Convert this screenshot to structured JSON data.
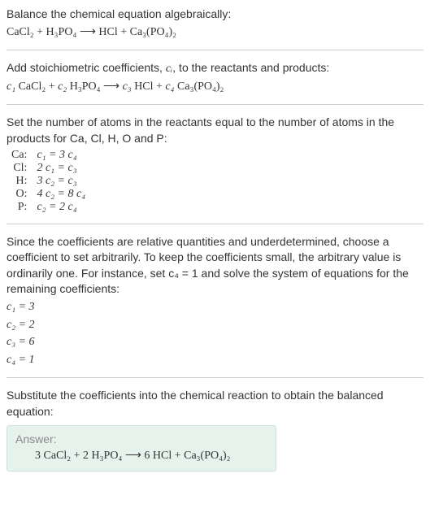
{
  "intro1": "Balance the chemical equation algebraically:",
  "eq1": "CaCl₂ + H₃PO₄  ⟶  HCl + Ca₃(PO₄)₂",
  "step2a": "Add stoichiometric coefficients, ",
  "step2_ci": "cᵢ",
  "step2b": ", to the reactants and products:",
  "eq2_c1": "c₁",
  "eq2_r1": " CaCl₂ + ",
  "eq2_c2": "c₂",
  "eq2_r2": " H₃PO₄  ⟶  ",
  "eq2_c3": "c₃",
  "eq2_r3": " HCl + ",
  "eq2_c4": "c₄",
  "eq2_r4": " Ca₃(PO₄)₂",
  "step3": "Set the number of atoms in the reactants equal to the number of atoms in the products for Ca, Cl, H, O and P:",
  "atoms": [
    {
      "el": "Ca:",
      "eq": "c₁ = 3 c₄"
    },
    {
      "el": "Cl:",
      "eq": "2 c₁ = c₃"
    },
    {
      "el": "H:",
      "eq": "3 c₂ = c₃"
    },
    {
      "el": "O:",
      "eq": "4 c₂ = 8 c₄"
    },
    {
      "el": "P:",
      "eq": "c₂ = 2 c₄"
    }
  ],
  "step4": "Since the coefficients are relative quantities and underdetermined, choose a coefficient to set arbitrarily. To keep the coefficients small, the arbitrary value is ordinarily one. For instance, set c₄ = 1 and solve the system of equations for the remaining coefficients:",
  "coeffs": [
    "c₁ = 3",
    "c₂ = 2",
    "c₃ = 6",
    "c₄ = 1"
  ],
  "step5": "Substitute the coefficients into the chemical reaction to obtain the balanced equation:",
  "answer_label": "Answer:",
  "answer_eq": "3 CaCl₂ + 2 H₃PO₄  ⟶  6 HCl + Ca₃(PO₄)₂"
}
